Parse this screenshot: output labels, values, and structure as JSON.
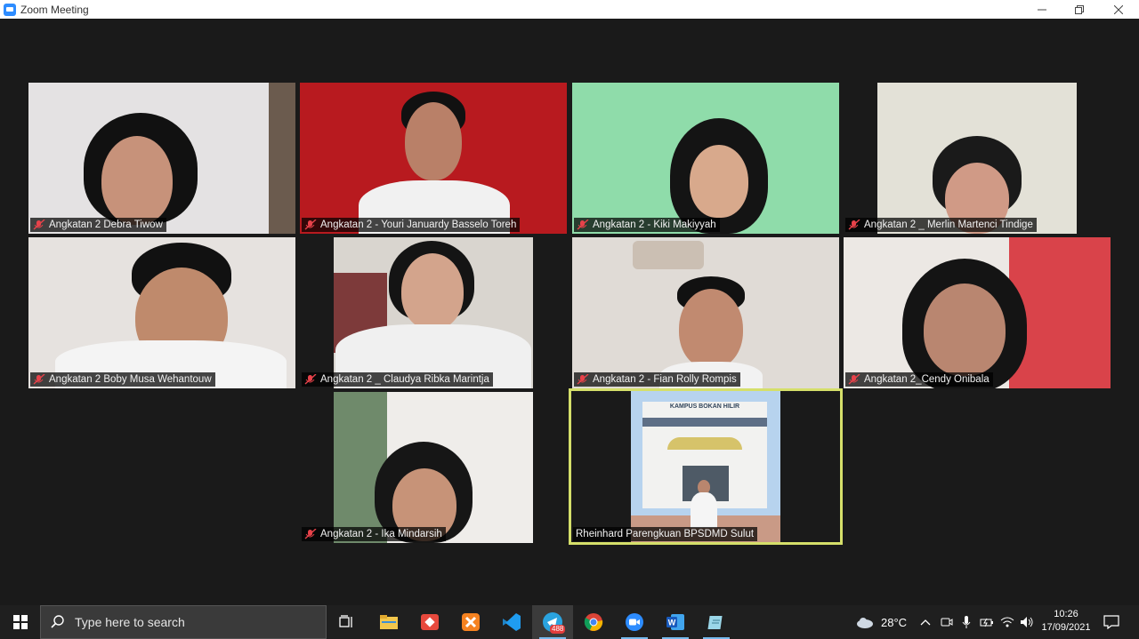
{
  "window": {
    "title": "Zoom Meeting"
  },
  "participants": [
    {
      "name": "Angkatan 2 Debra Tiwow",
      "muted": true
    },
    {
      "name": "Angkatan 2 - Youri Januardy Basselo Toreh",
      "muted": true
    },
    {
      "name": "Angkatan 2 - Kiki Makiyyah",
      "muted": true
    },
    {
      "name": "Angkatan 2 _ Merlin Martenci Tindige",
      "muted": true
    },
    {
      "name": "Angkatan 2 Boby Musa Wehantouw",
      "muted": true
    },
    {
      "name": "Angkatan 2 _ Claudya Ribka Marintja",
      "muted": true
    },
    {
      "name": "Angkatan 2 - Fian Rolly Rompis",
      "muted": true
    },
    {
      "name": "Angkatan 2_Cendy Onibala",
      "muted": true
    },
    {
      "name": "Angkatan 2 - Ika Mindarsih",
      "muted": true
    },
    {
      "name": "Rheinhard Parengkuan BPSDMD Sulut",
      "muted": false,
      "active_speaker": true
    }
  ],
  "virtual_background": {
    "sign_text": "KAMPUS BOKAN HILIR"
  },
  "taskbar": {
    "search_placeholder": "Type here to search",
    "telegram_badge": "488",
    "weather": "28°C",
    "time": "10:26",
    "date": "17/09/2021"
  },
  "colors": {
    "active_speaker_border": "#d5df6a",
    "muted_icon": "#e8424a",
    "zoom_blue": "#2d8cff"
  }
}
